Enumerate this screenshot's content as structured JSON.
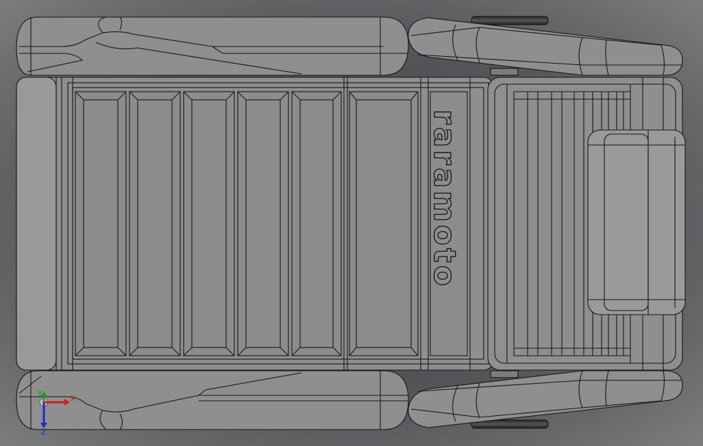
{
  "model": {
    "brand_text": "raramoto"
  },
  "triad": {
    "x_label": "X",
    "y_label": "Y",
    "z_label": "Z",
    "colors": {
      "x": "#d11a1a",
      "y": "#1aa11a",
      "z": "#1a2bd1"
    }
  },
  "colors": {
    "background_center": "#3f4041",
    "background_edge": "#7b7c7d",
    "body": "#8f8f8f",
    "edge": "#141414"
  }
}
